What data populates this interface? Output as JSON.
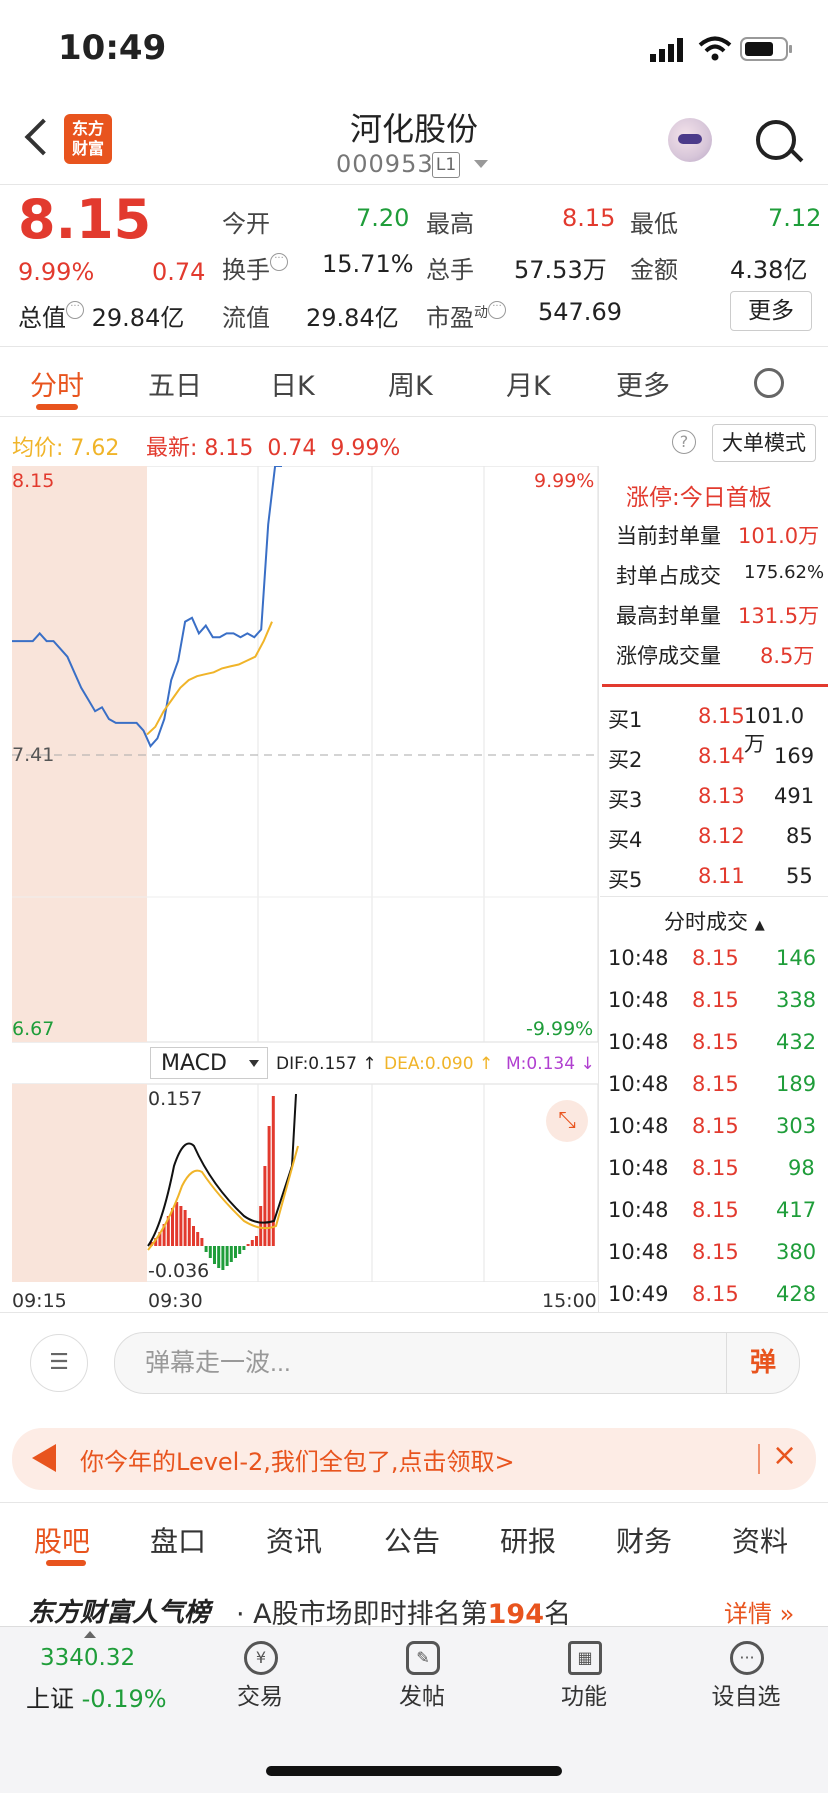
{
  "status": {
    "time": "10:49"
  },
  "header": {
    "logo_line1": "东方",
    "logo_line2": "财富",
    "title": "河化股份",
    "code": "000953",
    "level": "L1"
  },
  "quote": {
    "price": "8.15",
    "change_pct": "9.99%",
    "change": "0.74",
    "open_label": "今开",
    "open": "7.20",
    "high_label": "最高",
    "high": "8.15",
    "low_label": "最低",
    "low": "7.12",
    "turnover_label": "换手",
    "turnover": "15.71%",
    "volume_label": "总手",
    "volume": "57.53万",
    "amount_label": "金额",
    "amount": "4.38亿",
    "mcap_label": "总值",
    "mcap": "29.84亿",
    "float_label": "流值",
    "float": "29.84亿",
    "pe_label": "市盈",
    "pe_sup": "动",
    "pe": "547.69",
    "more": "更多"
  },
  "chart_tabs": [
    "分时",
    "五日",
    "日K",
    "周K",
    "月K",
    "更多"
  ],
  "infoline": {
    "avg_label": "均价:",
    "avg": "7.62",
    "latest_label": "最新:",
    "latest": "8.15",
    "chg": "0.74",
    "pct": "9.99%",
    "mode_btn": "大单模式",
    "help": "?"
  },
  "chart_data": {
    "type": "line",
    "series": [
      {
        "color": "#3a6fc6",
        "values": [
          7.7,
          7.7,
          7.7,
          7.7,
          7.72,
          7.7,
          7.7,
          7.68,
          7.66,
          7.62,
          7.58,
          7.55,
          7.52,
          7.53,
          7.5,
          7.49,
          7.49,
          7.49,
          7.49,
          7.47,
          7.43,
          7.45,
          7.5,
          7.6,
          7.65,
          7.75,
          7.76,
          7.72,
          7.74,
          7.71,
          7.71,
          7.72,
          7.72,
          7.71,
          7.72,
          7.71,
          7.73,
          8.0,
          8.15,
          8.15
        ]
      },
      {
        "color": "#f0b429",
        "values": [
          7.46,
          7.48,
          7.52,
          7.55,
          7.58,
          7.6,
          7.61,
          7.615,
          7.62,
          7.63,
          7.635,
          7.64,
          7.65,
          7.66,
          7.7,
          7.75
        ]
      }
    ],
    "price_top": "8.15",
    "price_mid": "7.41",
    "price_bottom": "6.67",
    "pct_top": "9.99%",
    "pct_bottom": "-9.99%",
    "ylim": [
      6.67,
      8.15
    ],
    "times": [
      "09:15",
      "09:30",
      "15:00"
    ]
  },
  "limit_panel": {
    "title": "涨停:今日首板",
    "rows": [
      {
        "label": "当前封单量",
        "value": "101.0万"
      },
      {
        "label": "封单占成交",
        "value": "175.62%"
      },
      {
        "label": "最高封单量",
        "value": "131.5万"
      },
      {
        "label": "涨停成交量",
        "value": "8.5万"
      }
    ]
  },
  "order_book": [
    {
      "label": "买1",
      "price": "8.15",
      "vol": "101.0万"
    },
    {
      "label": "买2",
      "price": "8.14",
      "vol": "169"
    },
    {
      "label": "买3",
      "price": "8.13",
      "vol": "491"
    },
    {
      "label": "买4",
      "price": "8.12",
      "vol": "85"
    },
    {
      "label": "买5",
      "price": "8.11",
      "vol": "55"
    }
  ],
  "ticks_header": "分时成交",
  "ticks": [
    {
      "time": "10:48",
      "price": "8.15",
      "vol": "146"
    },
    {
      "time": "10:48",
      "price": "8.15",
      "vol": "338"
    },
    {
      "time": "10:48",
      "price": "8.15",
      "vol": "432"
    },
    {
      "time": "10:48",
      "price": "8.15",
      "vol": "189"
    },
    {
      "time": "10:48",
      "price": "8.15",
      "vol": "303"
    },
    {
      "time": "10:48",
      "price": "8.15",
      "vol": "98"
    },
    {
      "time": "10:48",
      "price": "8.15",
      "vol": "417"
    },
    {
      "time": "10:48",
      "price": "8.15",
      "vol": "380"
    },
    {
      "time": "10:49",
      "price": "8.15",
      "vol": "428"
    }
  ],
  "macd": {
    "selector": "MACD",
    "dif": "DIF:0.157 ↑",
    "dea": "DEA:0.090 ↑",
    "m": "M:0.134 ↓",
    "top": "0.157",
    "bottom": "-0.036"
  },
  "danmu": {
    "placeholder": "弹幕走一波...",
    "send": "弹"
  },
  "banner": {
    "text": "你今年的Level-2,我们全包了,点击领取>",
    "close": "×"
  },
  "sub_tabs": [
    "股吧",
    "盘口",
    "资讯",
    "公告",
    "研报",
    "财务",
    "资料"
  ],
  "ranking": {
    "title": "东方财富人气榜",
    "text_pre": "· A股市场即时排名第",
    "rank": "194",
    "text_post": "名",
    "detail": "详情 »"
  },
  "bottom": {
    "index_value": "3340.32",
    "index_name": "上证",
    "index_pct": "-0.19%",
    "trade": "交易",
    "post": "发帖",
    "functions": "功能",
    "watchlist": "设自选"
  }
}
